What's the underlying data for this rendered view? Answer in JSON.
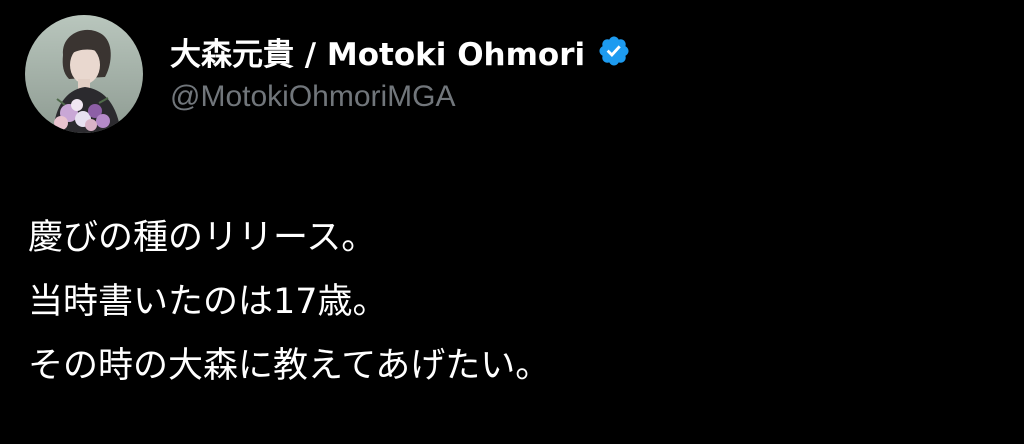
{
  "author": {
    "display_name": "大森元貴 / Motoki Ohmori",
    "handle": "@MotokiOhmoriMGA",
    "verified_icon": "verified-badge-icon",
    "verified_color": "#1d9bf0"
  },
  "tweet": {
    "lines": [
      "慶びの種のリリース。",
      "当時書いたのは17歳。",
      "その時の大森に教えてあげたい。"
    ]
  },
  "colors": {
    "background": "#000000",
    "text": "#ffffff",
    "handle": "#71767b"
  }
}
